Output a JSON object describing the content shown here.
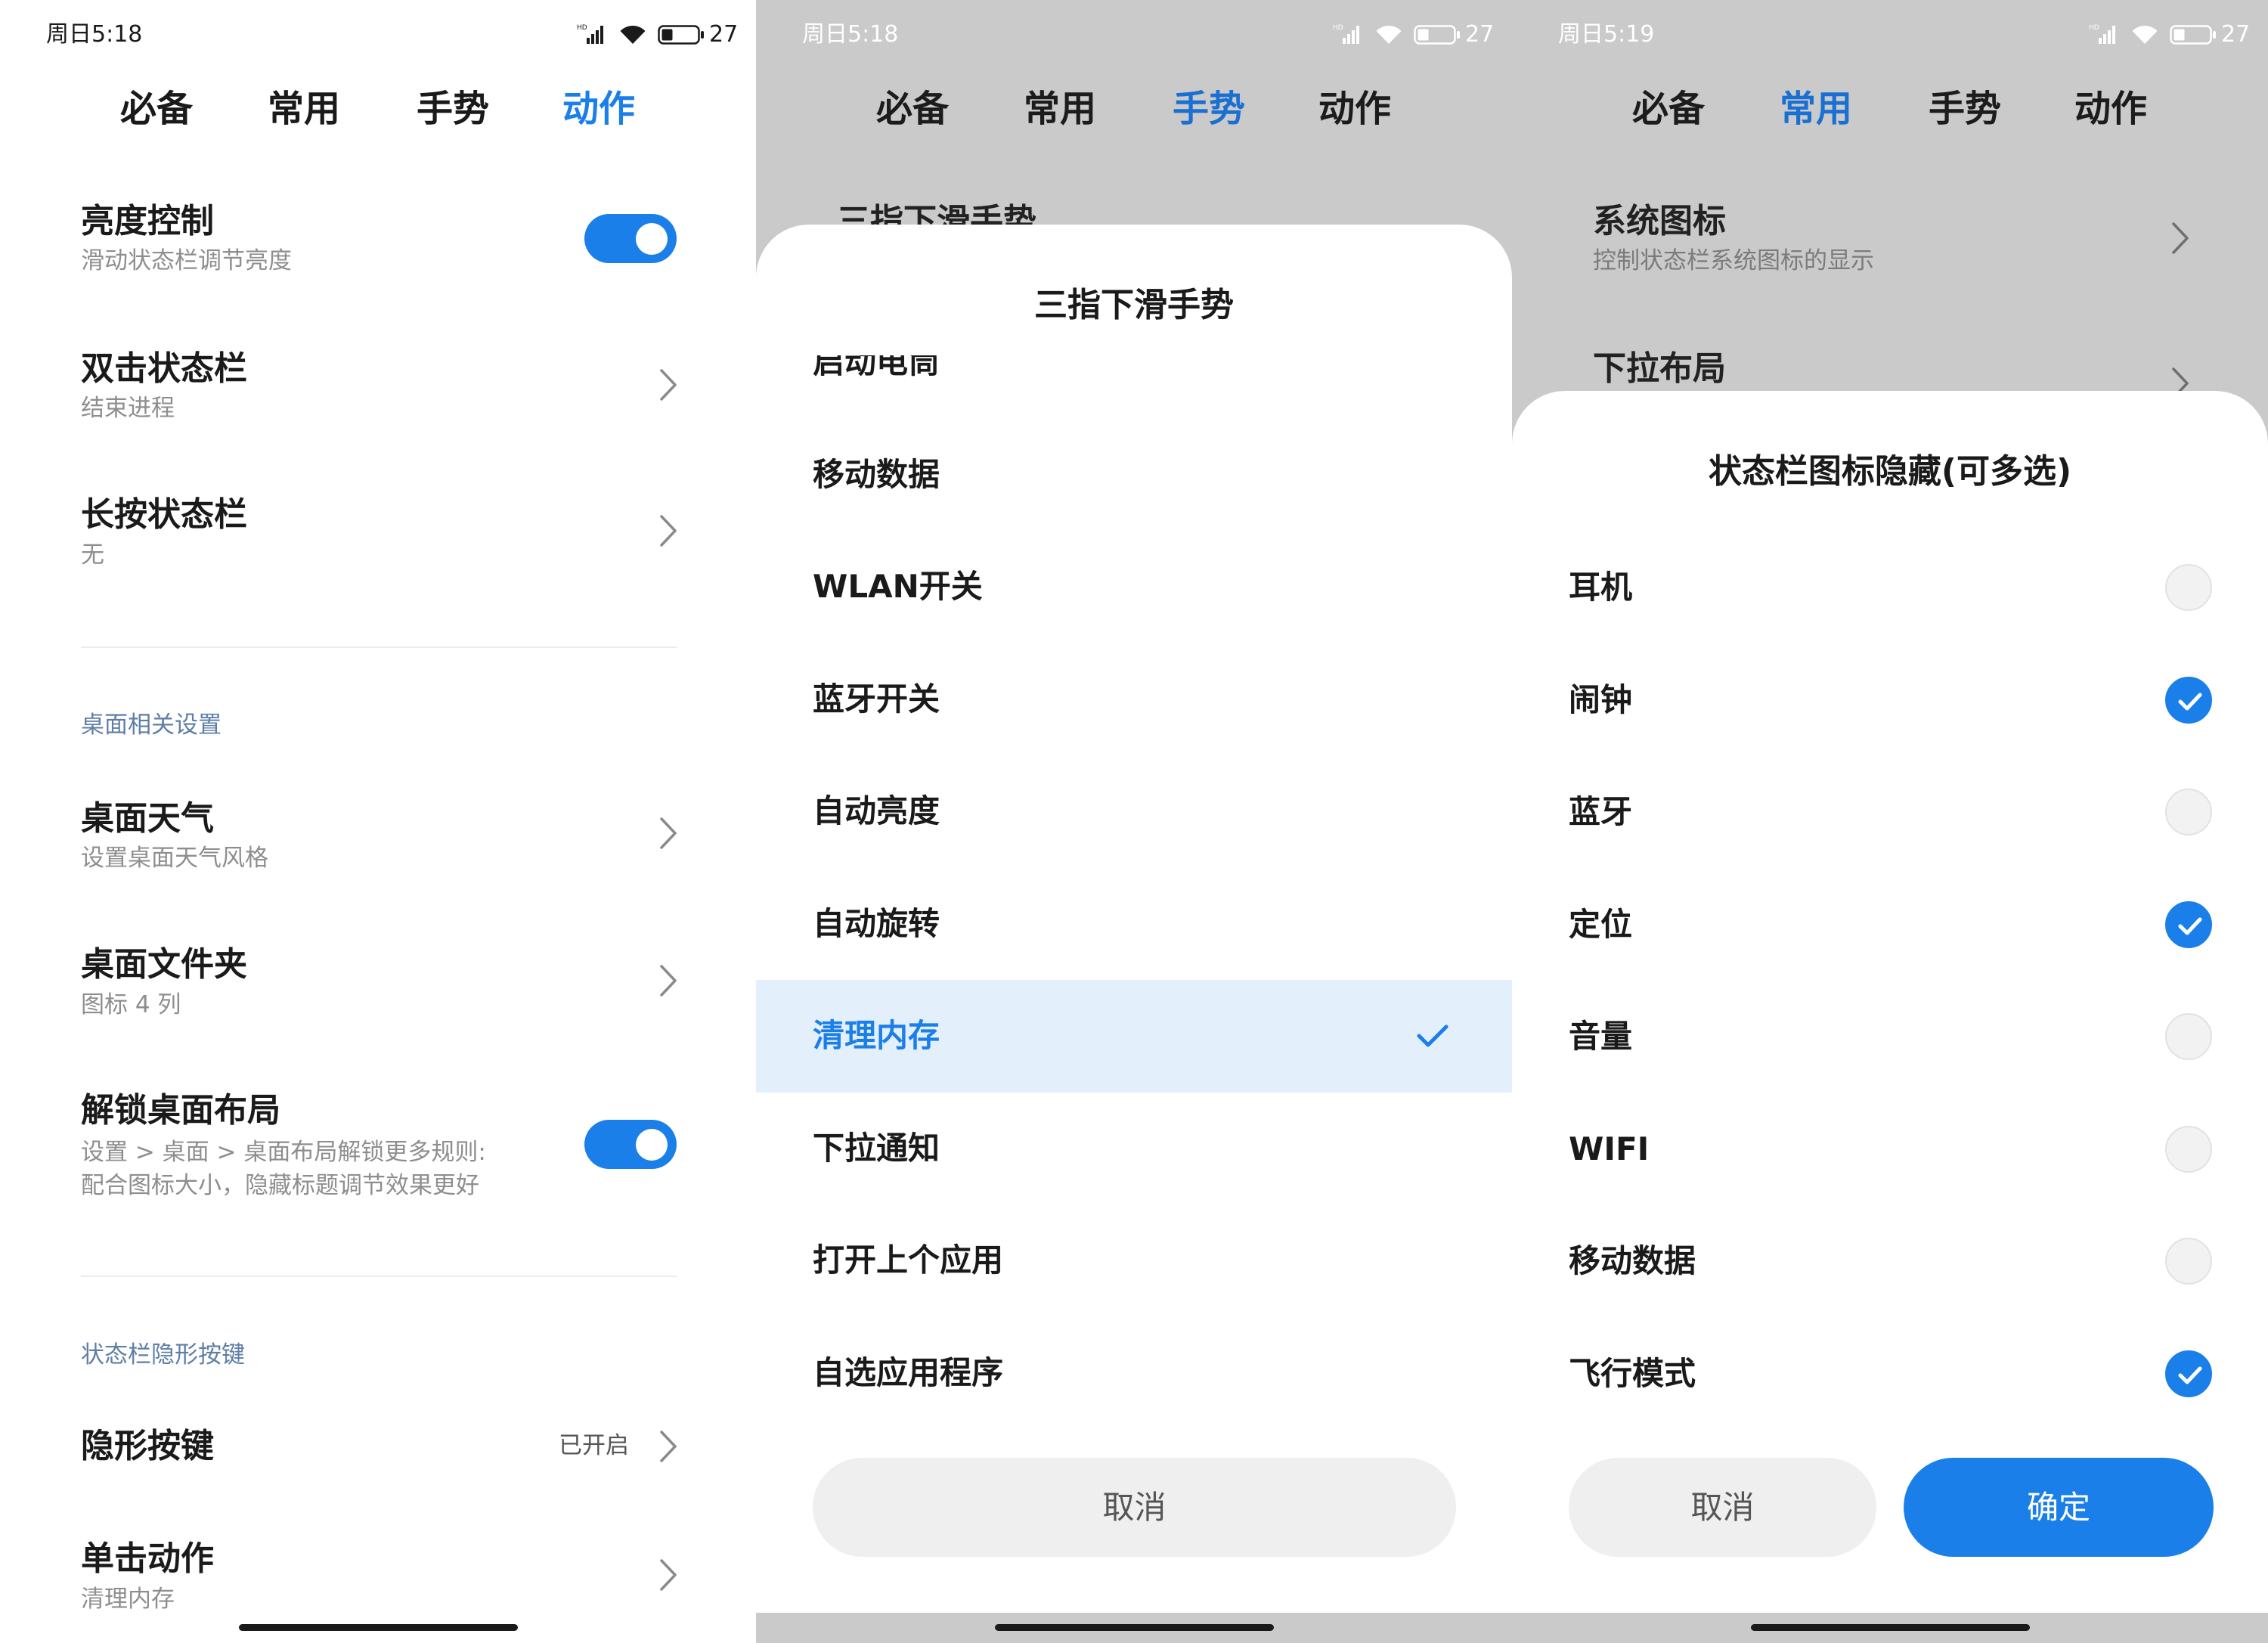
{
  "theme": {
    "accent": "#1b7fe9",
    "overlay": "#cacaca",
    "selected_row": "#e4effc",
    "section_header": "#5f7ea6"
  },
  "icons": {
    "status_bar": [
      "signal-icon",
      "wifi-icon",
      "battery-icon"
    ],
    "row_action": "chevron-right-icon",
    "selected_marker": "check-icon"
  },
  "screens": [
    {
      "status": {
        "time": "周日5:18",
        "network_badge": "HD",
        "battery": "27"
      },
      "tabs": [
        {
          "label": "必备",
          "active": false
        },
        {
          "label": "常用",
          "active": false
        },
        {
          "label": "手势",
          "active": false
        },
        {
          "label": "动作",
          "active": true
        }
      ],
      "rows": [
        {
          "title": "亮度控制",
          "subtitle": "滑动状态栏调节亮度",
          "toggle_on": true
        },
        {
          "title": "双击状态栏",
          "subtitle": "结束进程"
        },
        {
          "title": "长按状态栏",
          "subtitle": "无"
        }
      ],
      "sections": [
        {
          "header": "桌面相关设置",
          "rows": [
            {
              "title": "桌面天气",
              "subtitle": "设置桌面天气风格"
            },
            {
              "title": "桌面文件夹",
              "subtitle": "图标 4 列"
            },
            {
              "title": "解锁桌面布局",
              "subtitle_lines": [
                "设置 > 桌面 > 桌面布局解锁更多规则:",
                "配合图标大小，隐藏标题调节效果更好"
              ],
              "toggle_on": true
            }
          ]
        },
        {
          "header": "状态栏隐形按键",
          "rows": [
            {
              "title": "隐形按键",
              "value": "已开启"
            },
            {
              "title": "单击动作",
              "subtitle": "清理内存"
            }
          ]
        }
      ]
    },
    {
      "status": {
        "time": "周日5:18",
        "network_badge": "HD",
        "battery": "27"
      },
      "tabs": [
        {
          "label": "必备",
          "active": false
        },
        {
          "label": "常用",
          "active": false
        },
        {
          "label": "手势",
          "active": true
        },
        {
          "label": "动作",
          "active": false
        }
      ],
      "rows": [
        {
          "title": "三指下滑手势"
        }
      ],
      "sheet": {
        "title": "三指下滑手势",
        "options": [
          {
            "label": "启动电筒",
            "selected": false
          },
          {
            "label": "移动数据",
            "selected": false
          },
          {
            "label": "WLAN开关",
            "selected": false
          },
          {
            "label": "蓝牙开关",
            "selected": false
          },
          {
            "label": "自动亮度",
            "selected": false
          },
          {
            "label": "自动旋转",
            "selected": false
          },
          {
            "label": "清理内存",
            "selected": true
          },
          {
            "label": "下拉通知",
            "selected": false
          },
          {
            "label": "打开上个应用",
            "selected": false
          },
          {
            "label": "自选应用程序",
            "selected": false
          }
        ],
        "cancel_label": "取消"
      }
    },
    {
      "status": {
        "time": "周日5:19",
        "network_badge": "HD",
        "battery": "27"
      },
      "tabs": [
        {
          "label": "必备",
          "active": false
        },
        {
          "label": "常用",
          "active": true
        },
        {
          "label": "手势",
          "active": false
        },
        {
          "label": "动作",
          "active": false
        }
      ],
      "rows": [
        {
          "title": "系统图标",
          "subtitle": "控制状态栏系统图标的显示"
        },
        {
          "title": "下拉布局"
        }
      ],
      "sheet": {
        "title": "状态栏图标隐藏(可多选)",
        "options": [
          {
            "label": "耳机",
            "checked": false
          },
          {
            "label": "闹钟",
            "checked": true
          },
          {
            "label": "蓝牙",
            "checked": false
          },
          {
            "label": "定位",
            "checked": true
          },
          {
            "label": "音量",
            "checked": false
          },
          {
            "label": "WIFI",
            "checked": false
          },
          {
            "label": "移动数据",
            "checked": false
          },
          {
            "label": "飞行模式",
            "checked": true
          }
        ],
        "cancel_label": "取消",
        "confirm_label": "确定"
      }
    }
  ]
}
